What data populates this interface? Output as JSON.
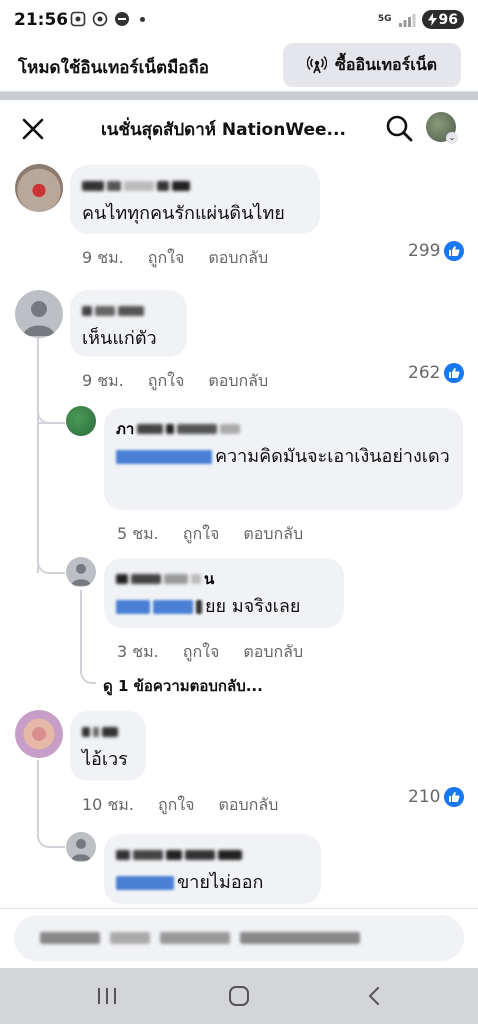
{
  "status_bar": {
    "time": "21:56",
    "network": "5G",
    "battery": "96"
  },
  "data_banner": {
    "label": "โหมดใช้อินเทอร์เน็ตมือถือ",
    "button": "ซื้ออินเทอร์เน็ต"
  },
  "header": {
    "title": "เนชั่นสุดสัปดาห์ NationWee..."
  },
  "comments": [
    {
      "text": "คนไททุกคนรักแผ่นดินไทย",
      "time": "9 ชม.",
      "like": "ถูกใจ",
      "reply": "ตอบกลับ",
      "reactions": "299"
    },
    {
      "text": "เห็นแก่ตัว",
      "time": "9 ชม.",
      "like": "ถูกใจ",
      "reply": "ตอบกลับ",
      "reactions": "262",
      "replies": [
        {
          "author_visible": "ภา",
          "text": "ความคิดมันจะเอาเงินอย่างเดว",
          "time": "5 ชม.",
          "like": "ถูกใจ",
          "reply": "ตอบกลับ"
        },
        {
          "author_visible": "น",
          "text": "ยย  มจริงเลย",
          "time": "3 ชม.",
          "like": "ถูกใจ",
          "reply": "ตอบกลับ"
        }
      ],
      "view_more": "ดู 1 ข้อความตอบกลับ..."
    },
    {
      "text": "ไอ้เวร",
      "time": "10 ชม.",
      "like": "ถูกใจ",
      "reply": "ตอบกลับ",
      "reactions": "210",
      "replies": [
        {
          "text": "ขายไม่ออก"
        }
      ]
    }
  ]
}
